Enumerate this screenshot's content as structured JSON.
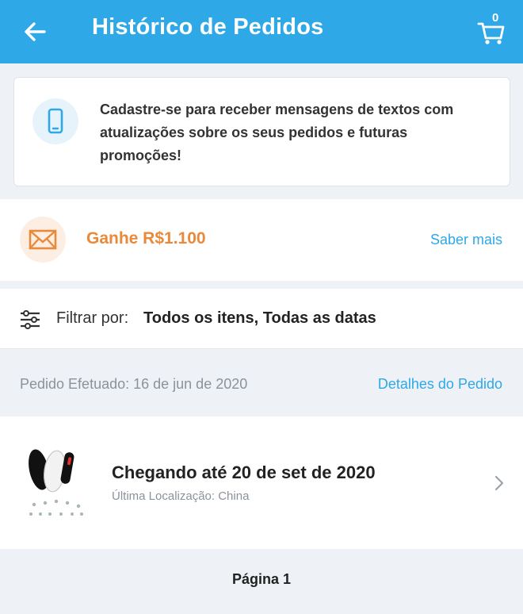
{
  "header": {
    "title": "Histórico de Pedidos",
    "cart_count": "0",
    "back_icon": "arrow-left-icon",
    "cart_icon": "cart-icon",
    "color": "#2ea8e6"
  },
  "sms_promo": {
    "icon": "smartphone-icon",
    "text": "Cadastre-se para receber mensagens de textos com atualizações sobre os seus pedidos e futuras promoções!"
  },
  "reward": {
    "icon": "envelope-icon",
    "title": "Ganhe R$1.100",
    "link": "Saber mais",
    "accent": "#e9893a"
  },
  "filter": {
    "icon": "sliders-icon",
    "label": "Filtrar por:",
    "value": "Todos os itens, Todas as datas"
  },
  "order": {
    "placed": "Pedido Efetuado: 16 de jun de 2020",
    "details_link": "Detalhes do Pedido",
    "item": {
      "title": "Chegando até 20 de set de 2020",
      "location": "Última Localização: China",
      "image": "smart-band-product-image"
    }
  },
  "pagination": {
    "label": "Página 1"
  }
}
